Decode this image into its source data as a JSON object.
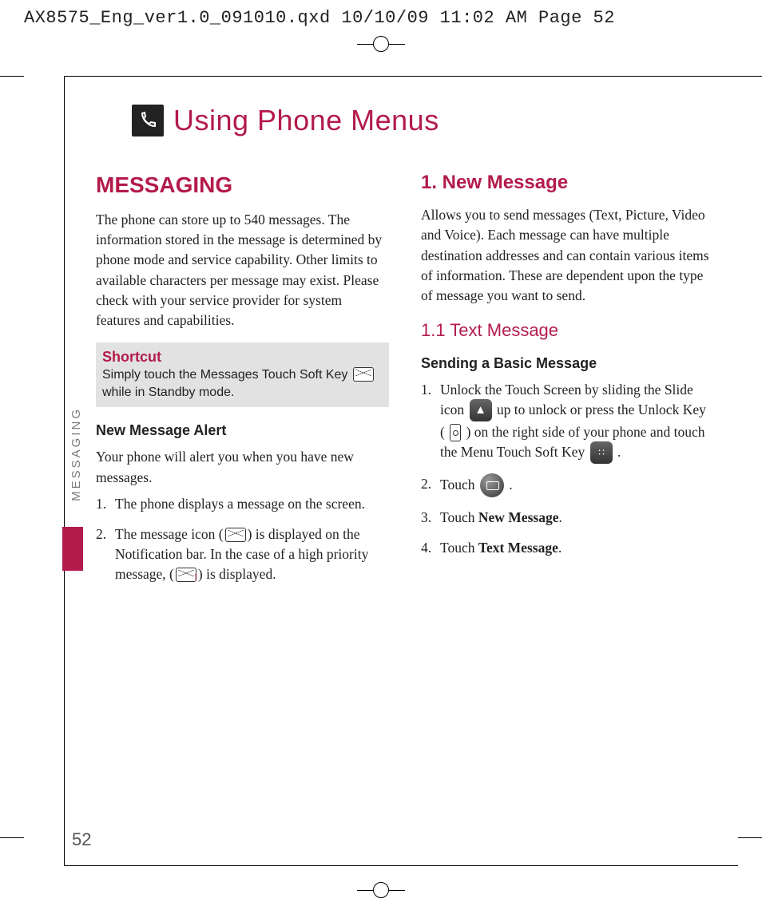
{
  "header": "AX8575_Eng_ver1.0_091010.qxd  10/10/09  11:02 AM  Page 52",
  "chapter_title": "Using Phone Menus",
  "side_tab": "MESSAGING",
  "page_number": "52",
  "left": {
    "h1": "MESSAGING",
    "intro": "The phone can store up to 540 messages. The information stored in the message is determined by phone mode and service capability. Other limits to available characters per message may exist. Please check with your service provider for system features and capabilities.",
    "shortcut_title": "Shortcut",
    "shortcut_a": "Simply touch the Messages Touch Soft Key ",
    "shortcut_b": " while in Standby mode.",
    "h2": "New Message Alert",
    "alert_intro": "Your phone will alert you when you have new messages.",
    "alert_1": "The phone displays a message on the screen.",
    "alert_2a": "The message icon (",
    "alert_2b": ") is displayed on the Notification bar. In the case of a high priority message, (",
    "alert_2c": ") is displayed."
  },
  "right": {
    "h1": "1. New Message",
    "intro": "Allows you to send messages (Text, Picture, Video and Voice). Each message can have multiple destination addresses and can contain various items of information. These are dependent upon the type of message you want to send.",
    "h2": "1.1 Text Message",
    "sub": "Sending a Basic Message",
    "s1a": "Unlock the Touch Screen by sliding the Slide icon ",
    "s1b": " up to unlock or press the Unlock Key ( ",
    "s1c": " ) on the right side of your phone and touch the Menu Touch Soft Key ",
    "s1d": " .",
    "s2a": "Touch ",
    "s2b": " .",
    "s3a": "Touch ",
    "s3b": "New Message",
    "s3c": ".",
    "s4a": "Touch ",
    "s4b": "Text Message",
    "s4c": "."
  }
}
